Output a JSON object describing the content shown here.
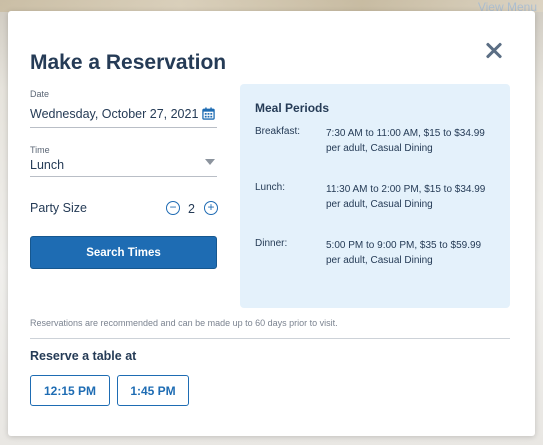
{
  "background": {
    "top_right_link": "View Menu"
  },
  "modal": {
    "title": "Make a Reservation",
    "date": {
      "label": "Date",
      "value": "Wednesday, October 27, 2021"
    },
    "time": {
      "label": "Time",
      "value": "Lunch"
    },
    "party_size": {
      "label": "Party Size",
      "decrement": "−",
      "count": "2",
      "increment": "+"
    },
    "search_button": "Search Times",
    "meal_periods": {
      "title": "Meal Periods",
      "items": [
        {
          "name": "Breakfast:",
          "description": "7:30 AM to 11:00 AM, $15 to $34.99 per adult, Casual Dining"
        },
        {
          "name": "Lunch:",
          "description": "11:30 AM to 2:00 PM, $15 to $34.99 per adult, Casual Dining"
        },
        {
          "name": "Dinner:",
          "description": "5:00 PM to 9:00 PM, $35 to $59.99 per adult, Casual Dining"
        }
      ]
    },
    "note": "Reservations are recommended and can be made up to 60 days prior to visit.",
    "reserve_title": "Reserve a table at",
    "time_slots": [
      "12:15 PM",
      "1:45 PM"
    ]
  },
  "colors": {
    "primary": "#1e6cb3",
    "text": "#253b56",
    "panel": "#e4f1fb"
  }
}
